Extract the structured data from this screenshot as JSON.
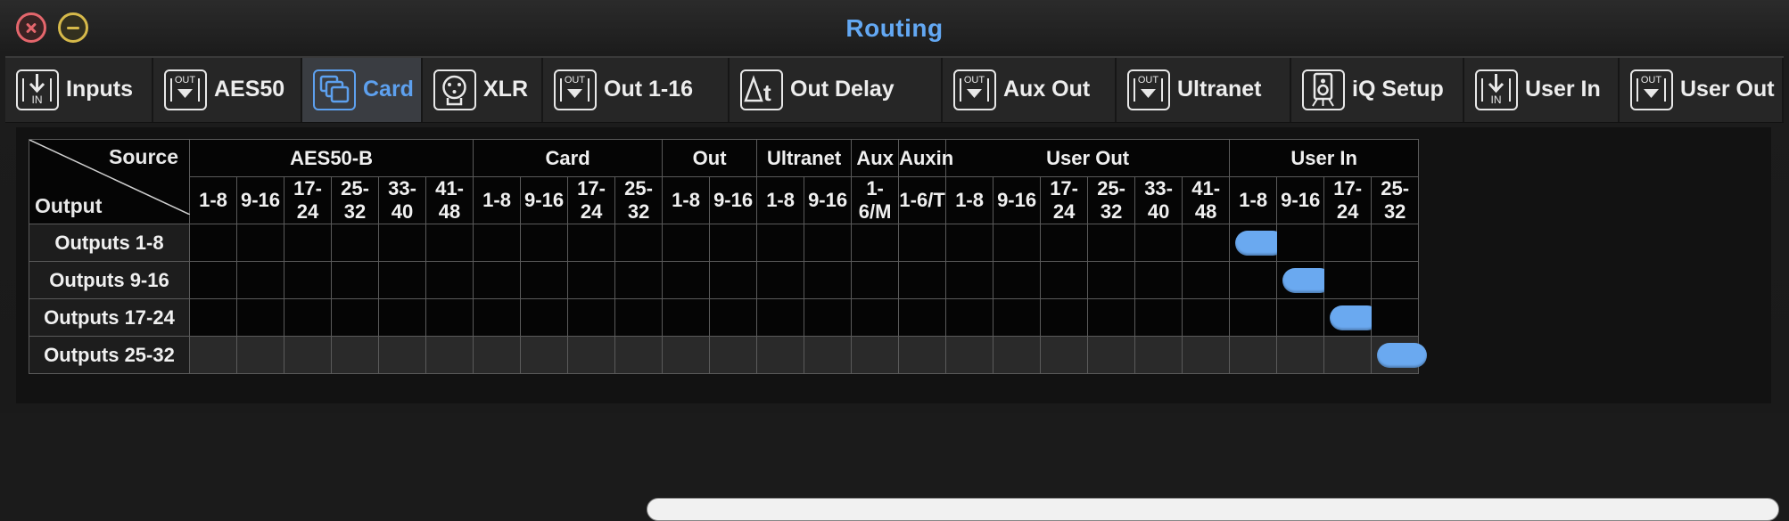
{
  "window": {
    "title": "Routing"
  },
  "tabs": [
    {
      "label": "Inputs",
      "icon": "in-arrow-icon",
      "icon_text": "IN",
      "active": false
    },
    {
      "label": "AES50",
      "icon": "out-arrow-icon",
      "icon_text": "OUT",
      "active": false
    },
    {
      "label": "Card",
      "icon": "card-icon",
      "icon_text": "",
      "active": true
    },
    {
      "label": "XLR",
      "icon": "xlr-connector-icon",
      "icon_text": "",
      "active": false
    },
    {
      "label": "Out 1-16",
      "icon": "out-arrow-icon",
      "icon_text": "OUT",
      "active": false
    },
    {
      "label": "Out Delay",
      "icon": "delta-t-icon",
      "icon_text": "Δt",
      "active": false
    },
    {
      "label": "Aux Out",
      "icon": "out-arrow-icon",
      "icon_text": "OUT",
      "active": false
    },
    {
      "label": "Ultranet",
      "icon": "out-arrow-icon",
      "icon_text": "OUT",
      "active": false
    },
    {
      "label": "iQ Setup",
      "icon": "speaker-icon",
      "icon_text": "",
      "active": false
    },
    {
      "label": "User In",
      "icon": "in-arrow-icon",
      "icon_text": "IN",
      "active": false
    },
    {
      "label": "User Out",
      "icon": "out-arrow-icon",
      "icon_text": "OUT",
      "active": false
    }
  ],
  "matrix": {
    "corner_source": "Source",
    "corner_output": "Output",
    "groups": [
      {
        "label": "AES50-B",
        "span": 6
      },
      {
        "label": "Card",
        "span": 4
      },
      {
        "label": "Out",
        "span": 2
      },
      {
        "label": "Ultranet",
        "span": 2
      },
      {
        "label": "Aux",
        "span": 1
      },
      {
        "label": "Auxin",
        "span": 1
      },
      {
        "label": "User Out",
        "span": 6
      },
      {
        "label": "User In",
        "span": 4
      }
    ],
    "columns": [
      "1-8",
      "9-16",
      "17-24",
      "25-32",
      "33-40",
      "41-48",
      "1-8",
      "9-16",
      "17-24",
      "25-32",
      "1-8",
      "9-16",
      "1-8",
      "9-16",
      "1-6/M",
      "1-6/T",
      "1-8",
      "9-16",
      "17-24",
      "25-32",
      "33-40",
      "41-48",
      "1-8",
      "9-16",
      "17-24",
      "25-32"
    ],
    "rows": [
      {
        "label": "Outputs 1-8",
        "routed_column": 22
      },
      {
        "label": "Outputs 9-16",
        "routed_column": 23
      },
      {
        "label": "Outputs 17-24",
        "routed_column": 24
      },
      {
        "label": "Outputs 25-32",
        "routed_column": 25
      }
    ]
  },
  "colors": {
    "accent": "#5da0ee",
    "pill": "#6aa9f0",
    "close": "#e4666c",
    "minimize": "#d6b94a"
  }
}
